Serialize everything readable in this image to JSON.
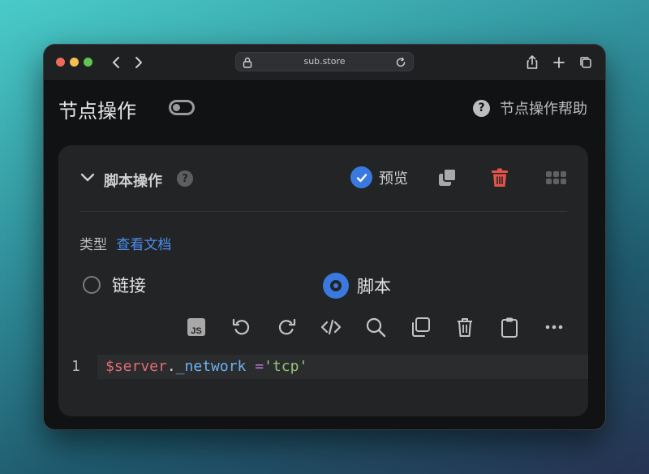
{
  "browser": {
    "url": "sub.store"
  },
  "page": {
    "title": "节点操作",
    "help_label": "节点操作帮助",
    "help_icon_glyph": "?"
  },
  "card": {
    "title": "脚本操作",
    "help_icon_glyph": "?",
    "preview_label": "预览",
    "preview_checked": true,
    "type_label": "类型",
    "doc_link": "查看文档",
    "radio_options": [
      {
        "label": "链接",
        "selected": false
      },
      {
        "label": "脚本",
        "selected": true
      }
    ],
    "toolbar_icons": [
      "js-icon",
      "undo-icon",
      "redo-icon",
      "code-icon",
      "search-icon",
      "copy-icon",
      "trash-icon",
      "clipboard-icon",
      "more-icon"
    ],
    "js_badge": "JS"
  },
  "editor": {
    "line_number": "1",
    "tokens": {
      "var": "$server",
      "dot": ".",
      "prop": "_network",
      "space": " ",
      "op": "=",
      "str": "'tcp'"
    }
  },
  "colors": {
    "accent": "#3a7ae0",
    "danger": "#e5534b",
    "link": "#4b8ef0",
    "card_bg": "#232425",
    "window_bg": "#111213"
  }
}
